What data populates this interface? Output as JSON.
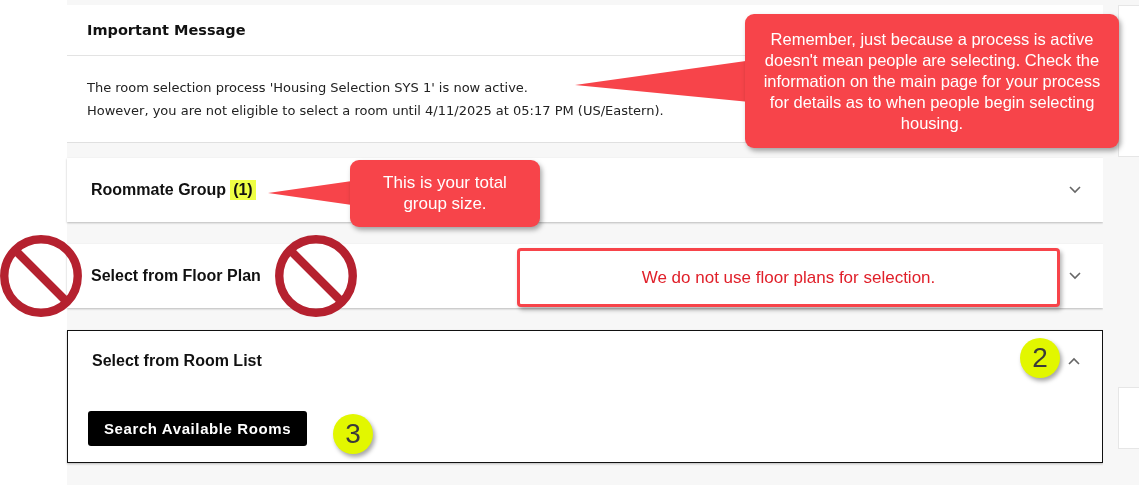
{
  "message": {
    "title": "Important Message",
    "lines": [
      "The room selection process 'Housing Selection SYS 1' is now active.",
      "However, you are not eligible to select a room until 4/11/2025 at 05:17 PM (US/Eastern)."
    ]
  },
  "sections": [
    {
      "title": "Roommate Group",
      "count": "(1)",
      "expanded": false,
      "focused": false
    },
    {
      "title": "Select from Floor Plan",
      "expanded": false,
      "focused": false
    },
    {
      "title": "Select from Room List",
      "expanded": true,
      "focused": true,
      "button": "Search Available Rooms"
    }
  ],
  "annotations": [
    {
      "kind": "callout",
      "text": "Remember, just because a process is active doesn't mean people are selecting. Check the information on the main page for your process for details as to when people begin selecting housing."
    },
    {
      "kind": "callout",
      "text": "This is your total group size."
    },
    {
      "kind": "note",
      "text": "We do not use floor plans for selection."
    },
    {
      "kind": "badge",
      "text": "2"
    },
    {
      "kind": "badge",
      "text": "3"
    },
    {
      "kind": "prohibited"
    },
    {
      "kind": "prohibited"
    }
  ]
}
